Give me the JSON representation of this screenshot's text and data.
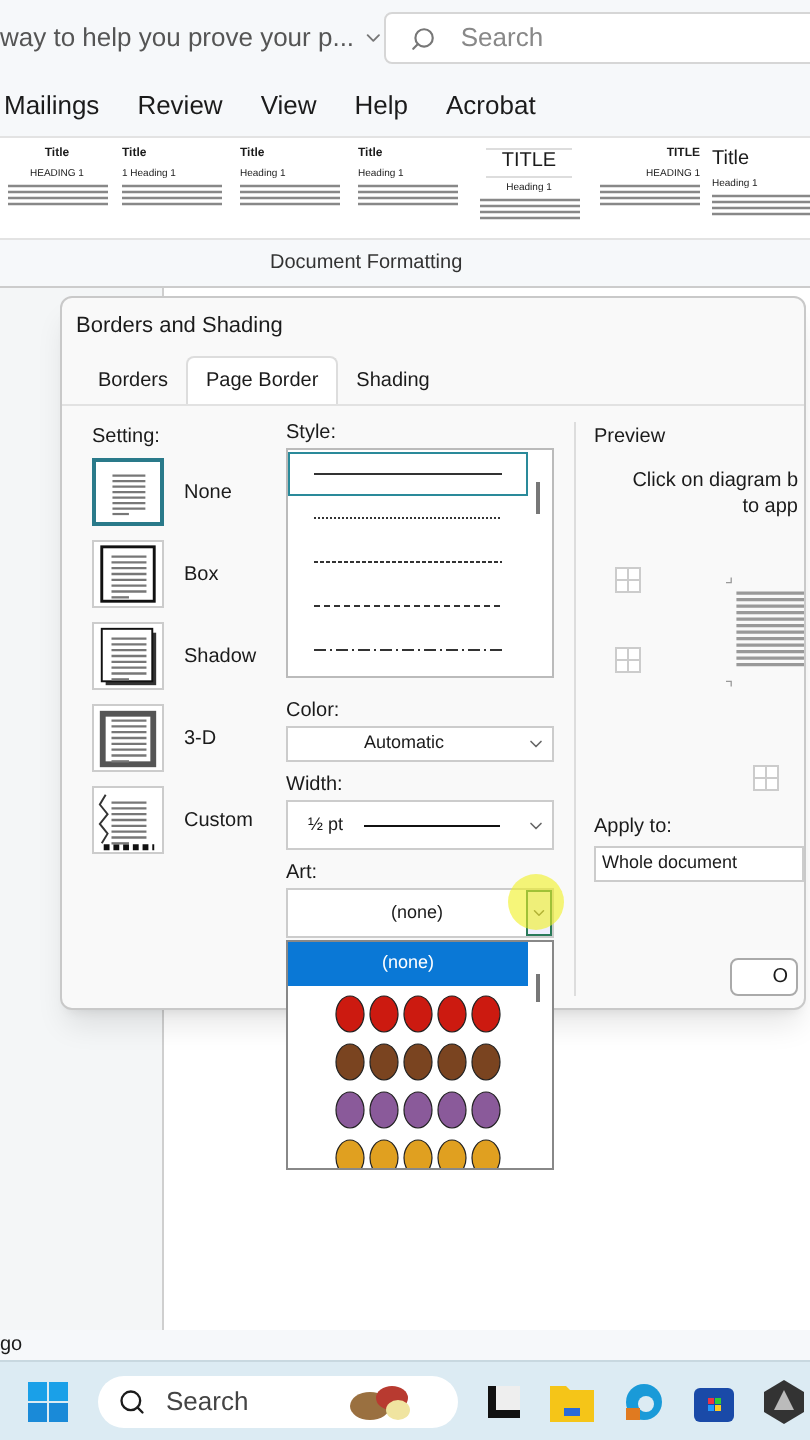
{
  "title_bar": {
    "document_title": "way to help you prove your p...",
    "search": {
      "placeholder": "Search"
    }
  },
  "menu_tabs": [
    {
      "label": "Mailings"
    },
    {
      "label": "Review"
    },
    {
      "label": "View"
    },
    {
      "label": "Help"
    },
    {
      "label": "Acrobat"
    }
  ],
  "style_gallery": [
    {
      "title": "Title",
      "heading": "HEADING 1",
      "kind": "center"
    },
    {
      "title": "Title",
      "heading": "1  Heading 1",
      "kind": "left"
    },
    {
      "title": "Title",
      "heading": "Heading 1",
      "kind": "left"
    },
    {
      "title": "Title",
      "heading": "Heading 1",
      "kind": "left"
    },
    {
      "title": "TITLE",
      "heading": "Heading 1",
      "kind": "boxed"
    },
    {
      "title": "TITLE",
      "heading": "HEADING 1",
      "kind": "right"
    },
    {
      "title": "Title",
      "heading": "Heading 1",
      "kind": "large"
    }
  ],
  "gallery_label": "Document Formatting",
  "dialog": {
    "title": "Borders and Shading",
    "tabs": [
      {
        "label": "Borders",
        "selected": false
      },
      {
        "label": "Page Border",
        "selected": true
      },
      {
        "label": "Shading",
        "selected": false
      }
    ],
    "setting": {
      "label": "Setting:",
      "options": [
        {
          "label": "None",
          "kind": "none",
          "selected": true
        },
        {
          "label": "Box",
          "kind": "box",
          "selected": false
        },
        {
          "label": "Shadow",
          "kind": "shadow",
          "selected": false
        },
        {
          "label": "3-D",
          "kind": "threed",
          "selected": false
        },
        {
          "label": "Custom",
          "kind": "custom",
          "selected": false
        }
      ]
    },
    "style": {
      "label": "Style:",
      "lines": [
        {
          "kind": "solid",
          "selected": true
        },
        {
          "kind": "dotted",
          "selected": false
        },
        {
          "kind": "finedash",
          "selected": false
        },
        {
          "kind": "dashed",
          "selected": false
        },
        {
          "kind": "dashdot",
          "selected": false
        }
      ]
    },
    "color": {
      "label": "Color:",
      "value": "Automatic"
    },
    "width": {
      "label": "Width:",
      "value": "½ pt"
    },
    "art": {
      "label": "Art:",
      "value": "(none)",
      "expanded": true,
      "options": [
        {
          "label": "(none)",
          "selected": true
        },
        {
          "selected": false,
          "color": "#cc1a10"
        },
        {
          "selected": false,
          "color": "#7a4420"
        },
        {
          "selected": false,
          "color": "#8a5a9a"
        },
        {
          "selected": false,
          "color": "#e0a020"
        }
      ]
    },
    "preview": {
      "label": "Preview",
      "hint": [
        "Click on diagram b",
        "to app"
      ]
    },
    "apply_to": {
      "label": "Apply to:",
      "value": "Whole document"
    },
    "ok_button": "O"
  },
  "status_bar": "go",
  "taskbar": {
    "search": {
      "placeholder": "Search"
    }
  }
}
